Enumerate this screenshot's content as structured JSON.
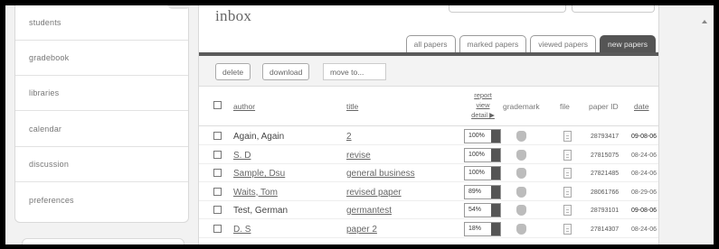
{
  "sidebar": {
    "items": [
      {
        "label": "students"
      },
      {
        "label": "gradebook"
      },
      {
        "label": "libraries"
      },
      {
        "label": "calendar"
      },
      {
        "label": "discussion"
      },
      {
        "label": "preferences"
      }
    ]
  },
  "main": {
    "title": "inbox",
    "tabs": [
      {
        "label": "all papers"
      },
      {
        "label": "marked papers"
      },
      {
        "label": "viewed papers"
      },
      {
        "label": "new papers"
      }
    ],
    "toolbar": {
      "delete_label": "delete",
      "download_label": "download",
      "move_label": "move to..."
    },
    "columns": {
      "author": "author",
      "title": "title",
      "report_1": "report",
      "report_2": "view",
      "report_3": "detail ▶",
      "grademark": "grademark",
      "file": "file",
      "paper_id": "paper ID",
      "date": "date"
    },
    "rows": [
      {
        "author": "Again, Again",
        "author_link": false,
        "title": "2",
        "report": "100%",
        "report_pct": 100,
        "paper_id": "28793417",
        "date": "09-08-06",
        "date_bold": true
      },
      {
        "author": "S. D",
        "author_link": true,
        "title": "revise",
        "report": "100%",
        "report_pct": 100,
        "paper_id": "27815075",
        "date": "08-24-06",
        "date_bold": false
      },
      {
        "author": "Sample, Dsu",
        "author_link": true,
        "title": "general business",
        "report": "100%",
        "report_pct": 100,
        "paper_id": "27821485",
        "date": "08-24-06",
        "date_bold": false
      },
      {
        "author": "Waits, Tom",
        "author_link": true,
        "title": "revised paper",
        "report": "89%",
        "report_pct": 89,
        "paper_id": "28061766",
        "date": "08-29-06",
        "date_bold": false
      },
      {
        "author": "Test, German",
        "author_link": false,
        "title": "germantest",
        "report": "54%",
        "report_pct": 54,
        "paper_id": "28793101",
        "date": "09-08-06",
        "date_bold": true
      },
      {
        "author": "D. S",
        "author_link": true,
        "title": "paper 2",
        "report": "18%",
        "report_pct": 18,
        "paper_id": "27814307",
        "date": "08-24-06",
        "date_bold": false
      }
    ]
  },
  "icons": {
    "grademark": "grademark-icon",
    "file": "file-icon"
  }
}
